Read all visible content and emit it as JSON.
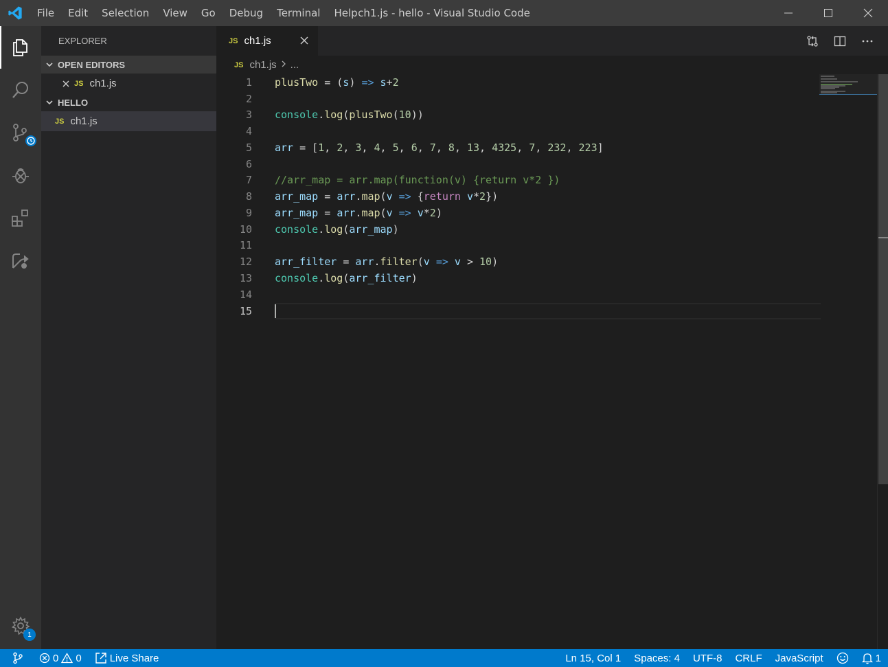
{
  "window": {
    "title": "ch1.js - hello - Visual Studio Code"
  },
  "menu": [
    "File",
    "Edit",
    "Selection",
    "View",
    "Go",
    "Debug",
    "Terminal",
    "Help"
  ],
  "activity_bar": {
    "items": [
      "files-icon",
      "search-icon",
      "source-control-icon",
      "debug-icon",
      "extensions-icon",
      "live-share-icon"
    ],
    "settings_badge": "1"
  },
  "sidebar": {
    "title": "EXPLORER",
    "open_editors_header": "OPEN EDITORS",
    "open_editors": [
      {
        "badge": "JS",
        "name": "ch1.js"
      }
    ],
    "folder_header": "HELLO",
    "files": [
      {
        "badge": "JS",
        "name": "ch1.js"
      }
    ]
  },
  "editor": {
    "tab": {
      "badge": "JS",
      "label": "ch1.js"
    },
    "breadcrumb": {
      "badge": "JS",
      "file": "ch1.js",
      "more": "..."
    },
    "current_line": 15,
    "lines": [
      "plusTwo = (s) => s+2",
      "",
      "console.log(plusTwo(10))",
      "",
      "arr = [1, 2, 3, 4, 5, 6, 7, 8, 13, 4325, 7, 232, 223]",
      "",
      "//arr_map = arr.map(function(v) {return v*2 })",
      "arr_map = arr.map(v => {return v*2})",
      "arr_map = arr.map(v => v*2)",
      "console.log(arr_map)",
      "",
      "arr_filter = arr.filter(v => v > 10)",
      "console.log(arr_filter)",
      "",
      ""
    ]
  },
  "statusbar": {
    "errors": "0",
    "warnings": "0",
    "live_share": "Live Share",
    "position": "Ln 15, Col 1",
    "spaces": "Spaces: 4",
    "encoding": "UTF-8",
    "eol": "CRLF",
    "language": "JavaScript",
    "notifications": "1"
  }
}
